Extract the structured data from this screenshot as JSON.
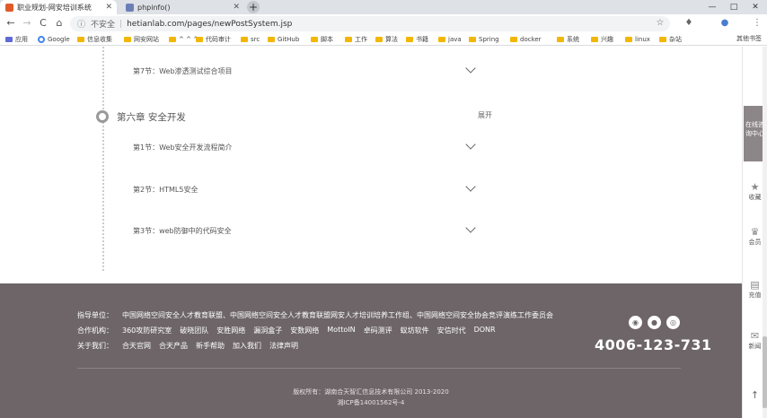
{
  "browser": {
    "tabs": [
      {
        "title": "职业规划-网安培训系统",
        "color": "#e05a2b"
      },
      {
        "title": "phpinfo()",
        "color": "#6a7fb5"
      }
    ],
    "new_tab_label": "+",
    "window_controls": {
      "minimize": "—",
      "maximize": "□",
      "close": "✕"
    },
    "nav": {
      "back": "←",
      "forward": "→",
      "reload": "C",
      "home": "⌂"
    },
    "address": {
      "security_label": "不安全",
      "url": "hetianlab.com/pages/newPostSystem.jsp",
      "separator": "|"
    },
    "omni_icons": {
      "star": "☆",
      "extension": "♦",
      "profile": "●",
      "menu": "⋮"
    },
    "bookmarks": [
      "应用",
      "Google",
      "信息收集",
      "网安网站",
      "^ ^ ^",
      "代码审计",
      "src",
      "GitHub",
      "脚本",
      "工作",
      "算法",
      "书籍",
      "java",
      "Spring",
      "docker",
      "系统",
      "兴趣",
      "linux",
      "杂站"
    ],
    "bookmarks_more": "其他书签"
  },
  "course": {
    "prev_lesson": "第7节：Web渗透测试综合项目",
    "chapter": {
      "title": "第六章 安全开发",
      "toggle": "展开"
    },
    "lessons": [
      "第1节：Web安全开发流程简介",
      "第2节：HTML5安全",
      "第3节：web防御中的代码安全"
    ]
  },
  "footer": {
    "guide_label": "指导单位：",
    "guide_text": "中国网络空间安全人才教育联盟、中国网络空间安全人才教育联盟网安人才培训培养工作组、中国网络空间安全协会竞评演练工作委员会",
    "partners_label": "合作机构：",
    "partners": [
      "360攻防研究室",
      "破晓团队",
      "安胜网络",
      "漏洞盒子",
      "安数网络",
      "MottoIN",
      "卓码测评",
      "蚁坊软件",
      "安信时代",
      "DONR"
    ],
    "about_label": "关于我们：",
    "about_links": [
      "合天官网",
      "合天产品",
      "新手帮助",
      "加入我们",
      "法律声明"
    ],
    "phone": "4006-123-731",
    "social_icons": [
      "qq",
      "wechat",
      "weibo"
    ],
    "copyright": "版权所有：湖南合天智汇信息技术有限公司 2013-2020",
    "icp": "湘ICP备14001562号-4"
  },
  "sidebar": {
    "main": "在线咨询中心",
    "items": [
      {
        "label": "收藏",
        "icon": "★"
      },
      {
        "label": "会员",
        "icon": "♛"
      },
      {
        "label": "充值",
        "icon": "▤"
      },
      {
        "label": "新闻",
        "icon": "✉"
      }
    ],
    "top": "↑"
  }
}
